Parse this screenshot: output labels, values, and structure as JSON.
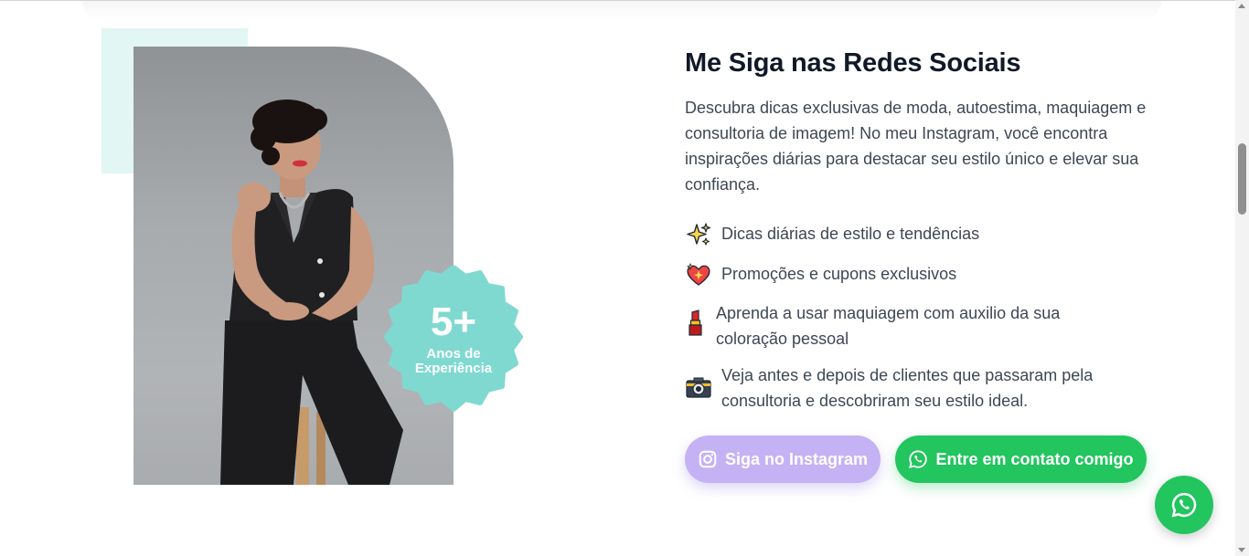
{
  "badge": {
    "number": "5+",
    "label_line1": "Anos de",
    "label_line2": "Experiência"
  },
  "section": {
    "title": "Me Siga nas Redes Sociais",
    "description": "Descubra dicas exclusivas de moda, autoestima, maquiagem e consultoria de imagem! No meu Instagram, você encontra inspirações diárias para destacar seu estilo único e elevar sua confiança."
  },
  "features": [
    {
      "icon": "sparkles-icon",
      "text": "Dicas diárias de estilo e tendências"
    },
    {
      "icon": "sparkling-heart-icon",
      "text": "Promoções e cupons exclusivos"
    },
    {
      "icon": "lipstick-icon",
      "text": "Aprenda a usar maquiagem com auxilio da sua coloração pessoal"
    },
    {
      "icon": "camera-icon",
      "text": "Veja antes e depois de clientes que passaram pela consultoria e descobriram seu estilo ideal."
    }
  ],
  "buttons": {
    "instagram_label": "Siga no Instagram",
    "whatsapp_label": "Entre em contato comigo"
  },
  "colors": {
    "mint": "#7fd9d1",
    "mint_light": "#e2f6f3",
    "instagram_button": "#c4b2f4",
    "whatsapp_green": "#22c55e",
    "heading": "#111827",
    "body_text": "#3f4654"
  }
}
